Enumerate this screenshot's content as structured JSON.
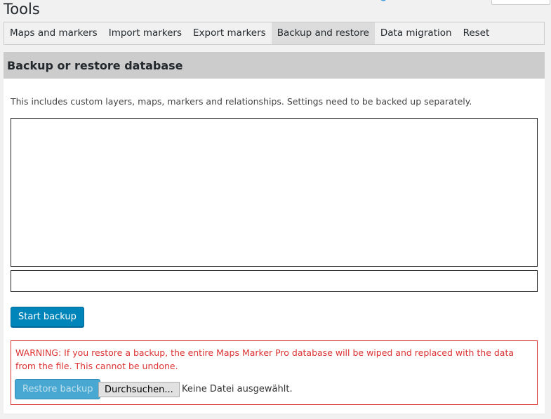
{
  "page": {
    "title": "Tools"
  },
  "tabs": [
    {
      "label": "Maps and markers",
      "active": false
    },
    {
      "label": "Import markers",
      "active": false
    },
    {
      "label": "Export markers",
      "active": false
    },
    {
      "label": "Backup and restore",
      "active": true
    },
    {
      "label": "Data migration",
      "active": false
    },
    {
      "label": "Reset",
      "active": false
    }
  ],
  "panel": {
    "title": "Backup or restore database",
    "description": "This includes custom layers, maps, markers and relationships. Settings need to be backed up separately.",
    "log_value": "",
    "progress": 0,
    "start_backup_label": "Start backup"
  },
  "warning": {
    "text": "WARNING: If you restore a backup, the entire Maps Marker Pro database will be wiped and replaced with the data from the file. This cannot be undone.",
    "restore_label": "Restore backup",
    "browse_label": "Durchsuchen...",
    "no_file_label": "Keine Datei ausgewählt."
  },
  "colors": {
    "primary": "#0085ba",
    "warning": "#dc3232",
    "header_bg": "#cccccc"
  }
}
